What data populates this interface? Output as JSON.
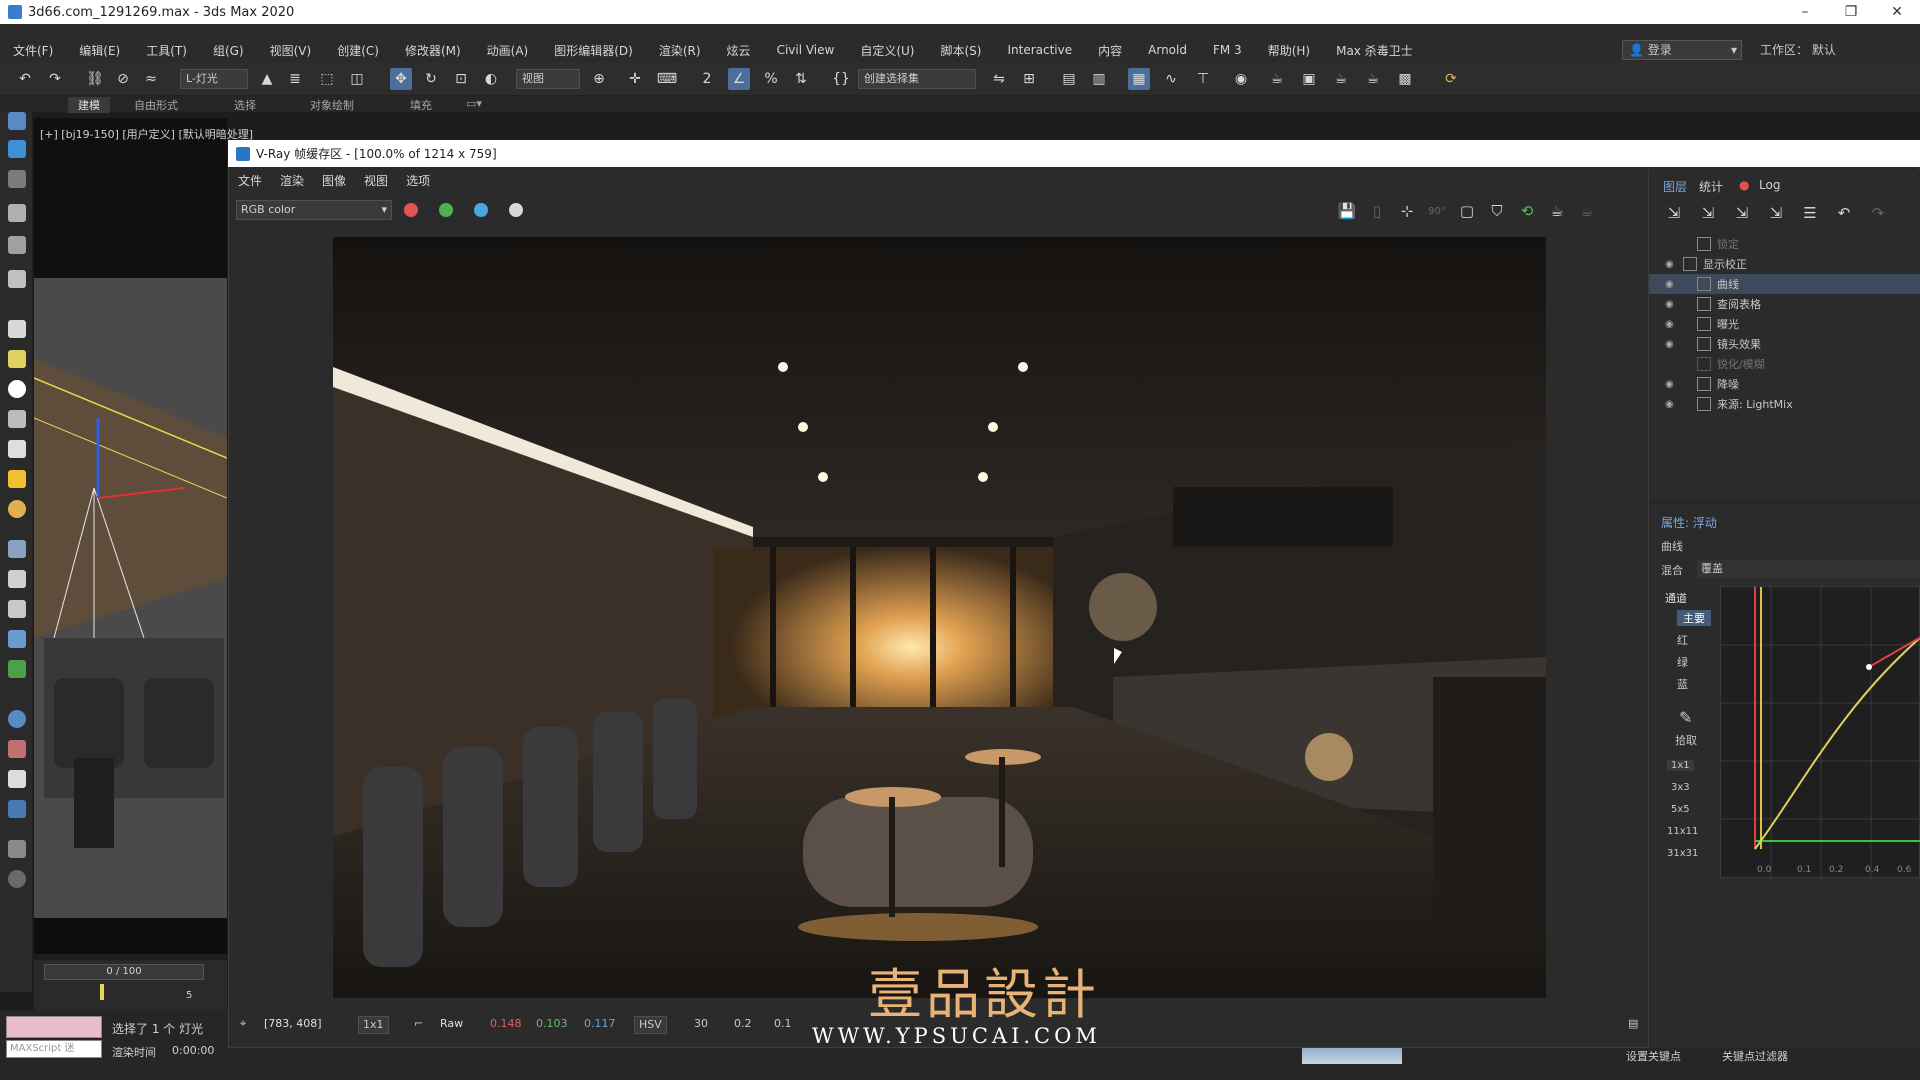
{
  "app": {
    "title": "3d66.com_1291269.max - 3ds Max 2020",
    "window_controls": [
      "–",
      "❐",
      "✕"
    ]
  },
  "menubar": {
    "items": [
      "文件(F)",
      "编辑(E)",
      "工具(T)",
      "组(G)",
      "视图(V)",
      "创建(C)",
      "修改器(M)",
      "动画(A)",
      "图形编辑器(D)",
      "渲染(R)",
      "炫云",
      "Civil View",
      "自定义(U)",
      "脚本(S)",
      "Interactive",
      "内容",
      "Arnold",
      "FM 3",
      "帮助(H)",
      "Max 杀毒卫士"
    ],
    "login_label": "登录",
    "workspace_label": "工作区：",
    "workspace_value": "默认"
  },
  "toolbar": {
    "filter_dropdown": "L-灯光",
    "view_dropdown": "视图",
    "selection_set_dropdown": "创建选择集"
  },
  "ribbon": {
    "tabs": [
      "建模",
      "自由形式",
      "选择",
      "对象绘制",
      "填充"
    ]
  },
  "viewport": {
    "label": "[+] [bj19-150] [用户定义] [默认明暗处理]"
  },
  "timeline": {
    "slider_label": "0 / 100",
    "tick_5": "5"
  },
  "status": {
    "script_box": "MAXScript 迷",
    "selected_text": "选择了 1 个 灯光",
    "render_time_label": "渲染时间",
    "render_time_value": "0:00:00",
    "set_key_label": "设置关键点",
    "key_filter_label": "关键点过滤器"
  },
  "vfb": {
    "title": "V-Ray 帧缓存区 - [100.0% of 1214 x 759]",
    "menu": [
      "文件",
      "渲染",
      "图像",
      "视图",
      "选项"
    ],
    "channel_dropdown": "RGB color",
    "colors": {
      "red": "#e05555",
      "green": "#4fb04f",
      "blue": "#4aa8e0"
    },
    "bottom": {
      "coords": "[783, 408]",
      "zoom": "1x1",
      "raw": "Raw",
      "r": "0.148",
      "g": "0.103",
      "b": "0.117",
      "mode": "HSV",
      "v1": "30",
      "v2": "0.2",
      "v3": "0.1"
    }
  },
  "watermark": {
    "logo": "壹品設計",
    "url": "WWW.YPSUCAI.COM"
  },
  "rpanel": {
    "tabs": [
      "图层",
      "统计",
      "Log"
    ],
    "layers": [
      {
        "label": "锁定",
        "dim": true
      },
      {
        "label": "显示校正",
        "dim": false
      },
      {
        "label": "曲线",
        "dim": false,
        "selected": true
      },
      {
        "label": "查阅表格",
        "dim": false
      },
      {
        "label": "曝光",
        "dim": false
      },
      {
        "label": "镜头效果",
        "dim": false
      },
      {
        "label": "锐化/模糊",
        "dim": true
      },
      {
        "label": "降噪",
        "dim": false
      },
      {
        "label": "来源: LightMix",
        "dim": false
      }
    ],
    "props_title": "属性: 浮动",
    "curve_label": "曲线",
    "blend_label": "混合",
    "blend_value": "覆盖",
    "channel_title": "通道",
    "channels": [
      "主要",
      "红",
      "绿",
      "蓝"
    ],
    "pick_label": "拾取",
    "sizes": [
      "1x1",
      "3x3",
      "5x5",
      "11x11",
      "31x31"
    ],
    "curve_ticks": [
      "0.0",
      "0.1",
      "0.2",
      "0.4",
      "0.6"
    ]
  }
}
